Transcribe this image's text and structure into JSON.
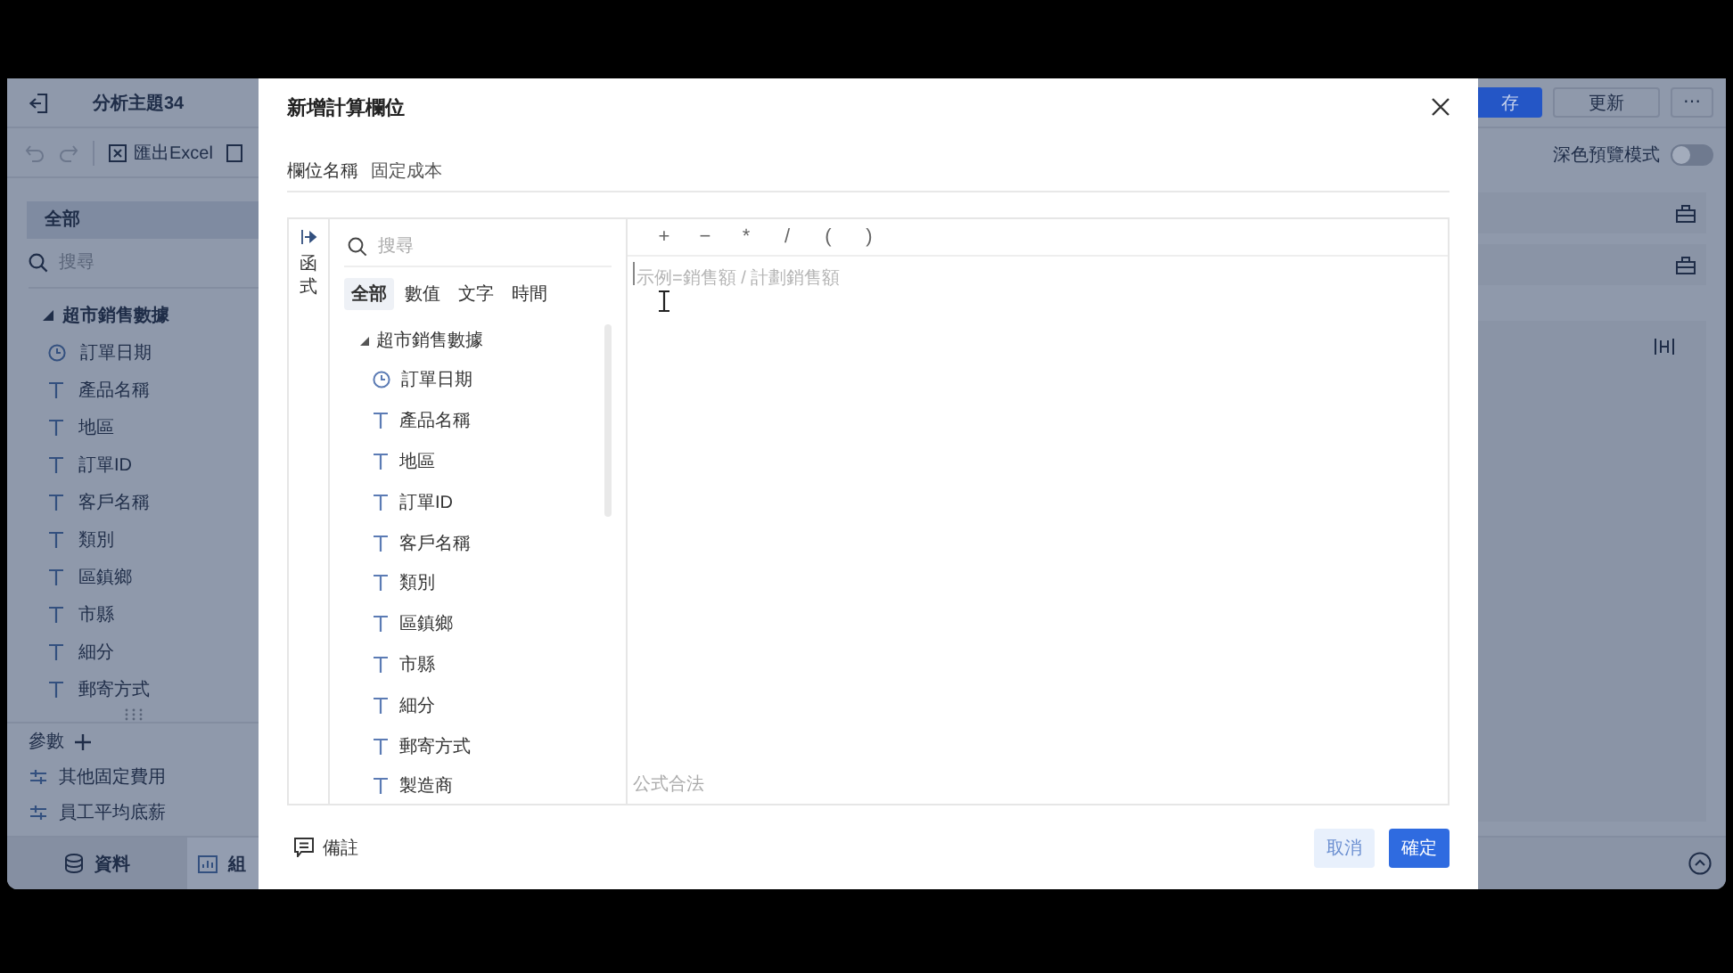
{
  "app": {
    "title": "分析主題34",
    "export_label": "匯出Excel",
    "sidebar": {
      "tabs": [
        {
          "label": "全部",
          "selected": true
        }
      ],
      "search": {
        "placeholder": "搜尋"
      },
      "tree": {
        "label": "超市銷售數據",
        "expanded": true,
        "children": [
          {
            "label": "訂單日期",
            "kind": "date"
          },
          {
            "label": "產品名稱",
            "kind": "text"
          },
          {
            "label": "地區",
            "kind": "text"
          },
          {
            "label": "訂單ID",
            "kind": "text"
          },
          {
            "label": "客戶名稱",
            "kind": "text"
          },
          {
            "label": "類別",
            "kind": "text"
          },
          {
            "label": "區鎮鄉",
            "kind": "text"
          },
          {
            "label": "市縣",
            "kind": "text"
          },
          {
            "label": "細分",
            "kind": "text"
          },
          {
            "label": "郵寄方式",
            "kind": "text"
          }
        ]
      },
      "params_label": "參數",
      "params": [
        "其他固定費用",
        "員工平均底薪"
      ]
    },
    "bottom_tabs": [
      {
        "label": "資料",
        "kind": "data",
        "selected": false
      },
      {
        "label": "組",
        "kind": "component",
        "selected": true
      }
    ],
    "header_buttons": [
      {
        "label": "存",
        "kind": "primary"
      },
      {
        "label": "更新",
        "kind": "default"
      },
      {
        "label": "⋯",
        "kind": "default"
      }
    ],
    "dark_preview": {
      "label": "深色預覽模式",
      "on": false
    }
  },
  "dialog": {
    "title": "新增計算欄位",
    "name_field": {
      "label": "欄位名稱",
      "value": "固定成本"
    },
    "function_tab": "函式",
    "field_search": {
      "placeholder": "搜尋"
    },
    "type_tabs": [
      {
        "label": "全部",
        "selected": true
      },
      {
        "label": "數值",
        "selected": false
      },
      {
        "label": "文字",
        "selected": false
      },
      {
        "label": "時間",
        "selected": false
      }
    ],
    "tree": {
      "label": "超市銷售數據",
      "expanded": true,
      "children": [
        {
          "label": "訂單日期",
          "kind": "date"
        },
        {
          "label": "產品名稱",
          "kind": "text"
        },
        {
          "label": "地區",
          "kind": "text"
        },
        {
          "label": "訂單ID",
          "kind": "text"
        },
        {
          "label": "客戶名稱",
          "kind": "text"
        },
        {
          "label": "類別",
          "kind": "text"
        },
        {
          "label": "區鎮鄉",
          "kind": "text"
        },
        {
          "label": "市縣",
          "kind": "text"
        },
        {
          "label": "細分",
          "kind": "text"
        },
        {
          "label": "郵寄方式",
          "kind": "text"
        },
        {
          "label": "製造商",
          "kind": "text"
        }
      ]
    },
    "operators": [
      "+",
      "−",
      "*",
      "/",
      "(",
      ")"
    ],
    "editor": {
      "placeholder": "示例=銷售額 / 計劃銷售額"
    },
    "status": "公式合法",
    "note_label": "備註",
    "buttons": [
      {
        "label": "取消",
        "kind": "secondary"
      },
      {
        "label": "確定",
        "kind": "primary"
      }
    ]
  }
}
